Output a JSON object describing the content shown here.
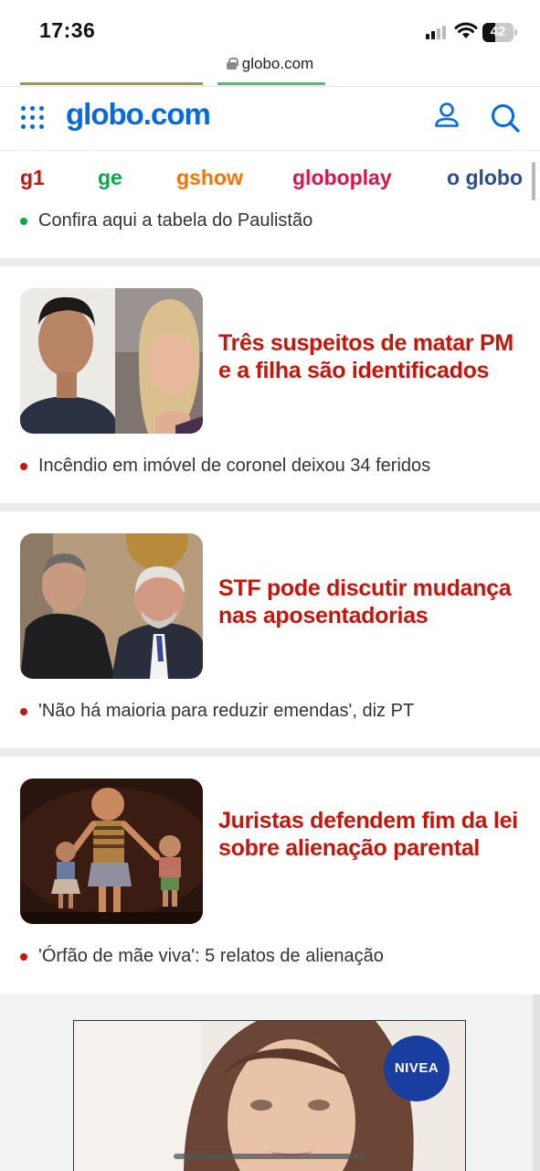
{
  "status_bar": {
    "time": "17:36",
    "battery": "42",
    "battery_level_percent": 42
  },
  "browser": {
    "url": "globo.com"
  },
  "header": {
    "logo": "globo.com",
    "brand_color": "#0669de"
  },
  "brands": [
    {
      "label": "g1",
      "color": "#c4170c"
    },
    {
      "label": "ge",
      "color": "#06aa48"
    },
    {
      "label": "gshow",
      "color": "#fa7100"
    },
    {
      "label": "globoplay",
      "color": "#d6174d"
    },
    {
      "label": "o globo",
      "color": "#2a4e8c"
    }
  ],
  "feed": {
    "top_bullet": {
      "text": "Confira aqui a tabela do Paulistão",
      "dot_color": "#06aa48"
    },
    "cards": [
      {
        "headline": "Três suspeitos de matar PM e a filha são identificados",
        "bullet": "Incêndio em imóvel de coronel deixou 34 feridos"
      },
      {
        "headline": "STF pode discutir mudança nas aposentadorias",
        "bullet": "'Não há maioria para reduzir emendas', diz PT"
      },
      {
        "headline": "Juristas defendem fim da lei sobre alienação parental",
        "bullet": "'Órfão de mãe viva': 5 relatos de alienação"
      }
    ],
    "headline_color": "#c4170c",
    "bullet_dot_color": "#c4170c"
  },
  "ad": {
    "brand": "NIVEA"
  }
}
